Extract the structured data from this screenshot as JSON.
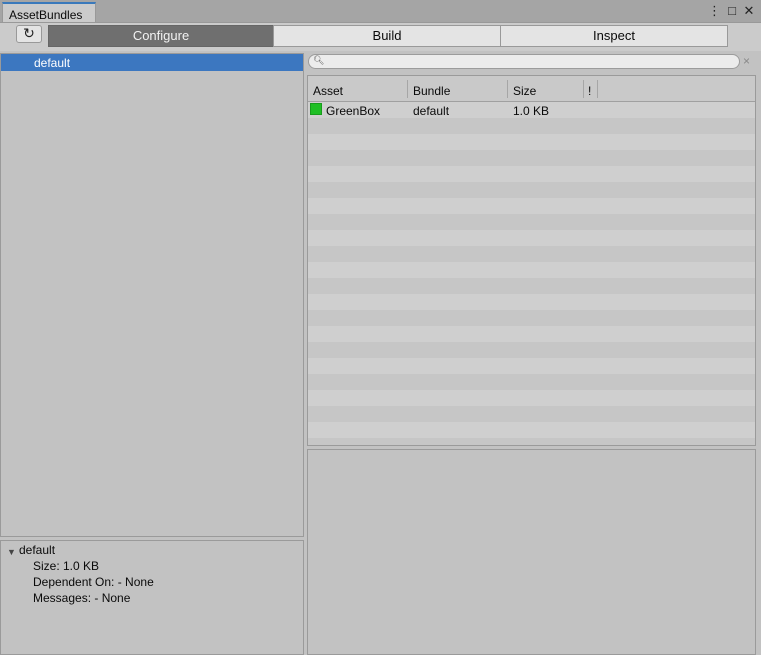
{
  "window": {
    "tab_title": "AssetBundles",
    "menu_icon": "⋮",
    "maximize_icon": "□",
    "close_icon": "✕"
  },
  "toolbar": {
    "refresh_icon": "↻",
    "modes": [
      "Configure",
      "Build",
      "Inspect"
    ],
    "active_mode": "Configure"
  },
  "bundles": {
    "items": [
      "default"
    ],
    "selected": "default"
  },
  "details": {
    "name": "default",
    "size": "Size: 1.0 KB",
    "dependent_on": "Dependent On: - None",
    "messages": "Messages: - None"
  },
  "search": {
    "placeholder": "",
    "clear_icon": "×"
  },
  "asset_table": {
    "columns": [
      "Asset",
      "Bundle",
      "Size",
      "!"
    ],
    "rows": [
      {
        "asset": "GreenBox",
        "bundle": "default",
        "size": "1.0 KB",
        "icon": "green-cube-icon",
        "icon_color": "#1fbf24"
      }
    ]
  },
  "colors": {
    "selection": "#3c77c0",
    "active_tab_accent": "#3a79bb",
    "panel_bg": "#c2c2c2"
  }
}
